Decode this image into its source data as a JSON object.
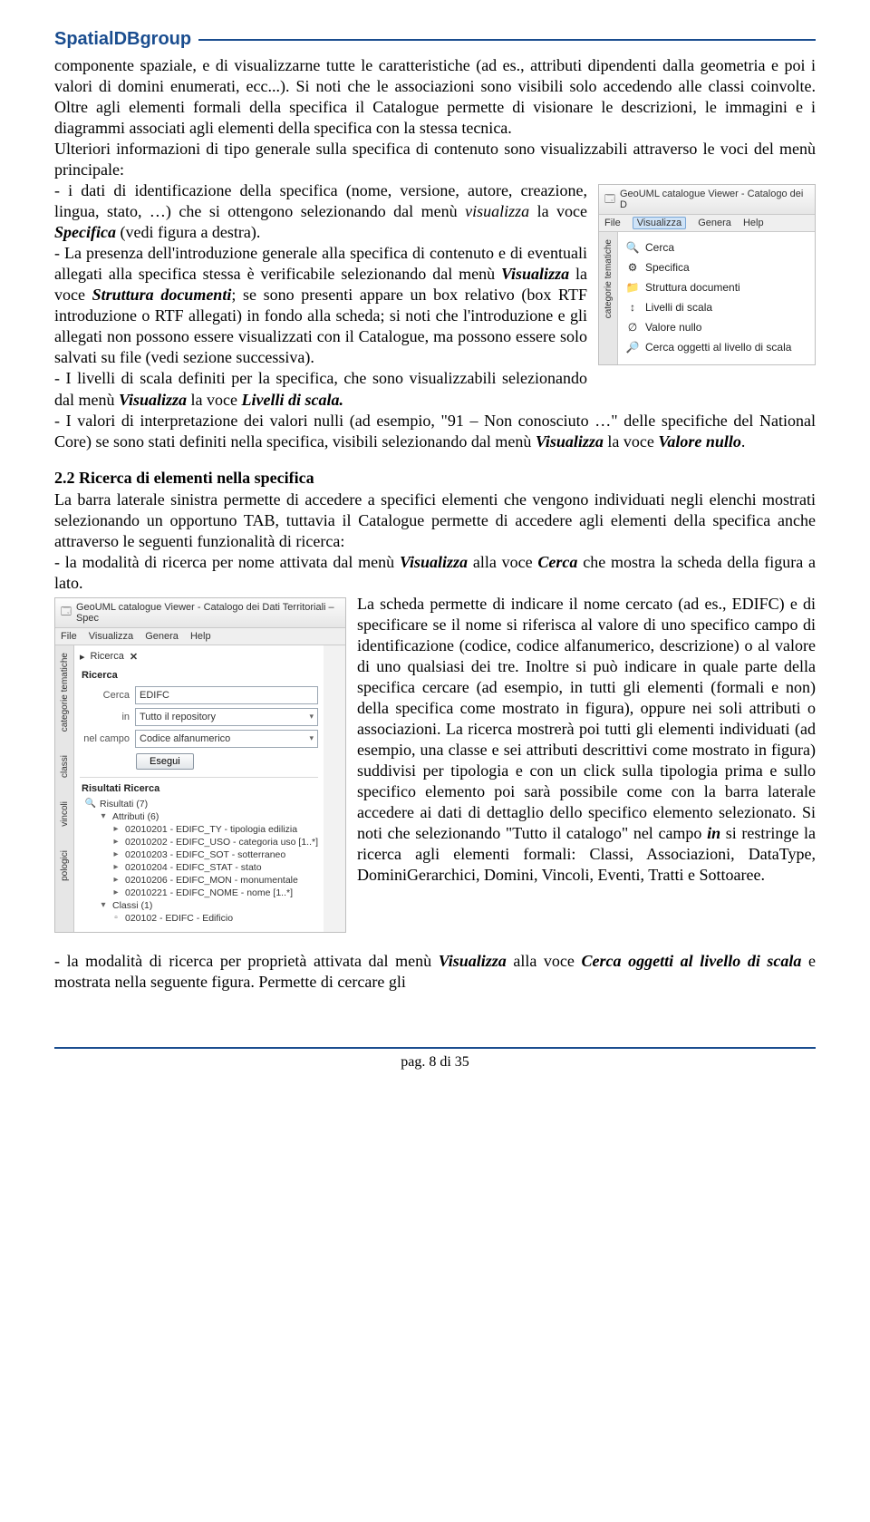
{
  "header": {
    "logo_text": "SpatialDBgroup"
  },
  "para1": "componente spaziale, e di visualizzarne tutte le caratteristiche (ad es., attributi dipendenti dalla geometria e poi i valori di domini enumerati, ecc...). Si noti che le associazioni sono visibili solo accedendo alle classi coinvolte. Oltre agli elementi formali della specifica il Catalogue permette di visionare le descrizioni, le immagini e i diagrammi associati agli elementi della specifica con la stessa tecnica.",
  "para2": "Ulteriori informazioni di tipo generale sulla specifica di contenuto sono visualizzabili attraverso le voci del menù principale:",
  "bullet1_a": "- i dati di identificazione della specifica (nome, versione, autore, creazione, lingua, stato, …) che si ottengono selezionando dal menù ",
  "bullet1_b": " la voce ",
  "bullet1_c": " (vedi figura a destra).",
  "em_visualizza_lc": "visualizza",
  "em_specifica": "Specifica",
  "bullet2_a": "- La presenza dell'introduzione generale alla specifica di contenuto e di eventuali allegati alla specifica stessa è verificabile selezionando dal menù ",
  "em_visualizza": "Visualizza",
  "bullet2_b": " la voce ",
  "em_struttura_doc": "Struttura documenti",
  "bullet2_c": "; se sono presenti appare un box relativo (box RTF introduzione o RTF allegati) in fondo alla scheda; si noti che l'introduzione e gli allegati non possono essere visualizzati con il Catalogue, ma possono essere solo salvati su file (vedi sezione successiva).",
  "bullet3_a": "- I livelli di scala definiti per la specifica, che sono visualizzabili selezionando dal menù ",
  "bullet3_b": " la voce ",
  "em_livelli": "Livelli di scala.",
  "bullet4_a": "- I valori di interpretazione dei valori nulli (ad esempio, \"91 – Non conosciuto …\" delle specifiche del National Core) se sono stati definiti nella specifica, visibili selezionando dal menù ",
  "bullet4_b": " la voce ",
  "em_valore_nullo": "Valore nullo",
  "period": ".",
  "section22_title": "2.2 Ricerca di elementi nella specifica",
  "section22_intro": "La barra laterale sinistra permette di accedere a specifici elementi che vengono individuati negli elenchi mostrati selezionando un opportuno TAB, tuttavia il Catalogue permette di accedere agli elementi della specifica anche attraverso le seguenti funzionalità di ricerca:",
  "section22_m1_a": "- la modalità di ricerca per nome attivata dal menù ",
  "section22_m1_b": " alla voce ",
  "em_cerca": "Cerca",
  "section22_m1_c": " che mostra la scheda della figura a lato.",
  "section22_m1_body_a": "La scheda permette di indicare il nome cercato (ad es., EDIFC) e di specificare se il nome si riferisca al valore di uno specifico campo di identificazione (codice, codice alfanumerico, descrizione) o al valore di uno qualsiasi dei tre. Inoltre si può indicare in quale parte della specifica cercare (ad esempio, in tutti gli elementi (formali e non) della specifica come mostrato in figura), oppure nei soli attributi o associazioni. La ricerca mostrerà poi tutti gli elementi individuati (ad esempio, una classe e sei attributi descrittivi come mostrato in figura) suddivisi per tipologia e con un click sulla tipologia prima e sullo specifico elemento poi sarà possibile come con la barra laterale accedere ai dati di dettaglio dello specifico elemento selezionato. Si noti che selezionando \"Tutto il catalogo\" nel campo ",
  "em_in": "in",
  "section22_m1_body_b": " si restringe la ricerca agli elementi formali: Classi, Associazioni, DataType, DominiGerarchici, Domini, Vincoli, Eventi, Tratti e Sottoaree.",
  "section22_m2_a": "- la modalità di ricerca per proprietà attivata dal menù ",
  "section22_m2_b": " alla voce ",
  "em_cerca_oggetti": "Cerca oggetti al livello di scala",
  "section22_m2_c": " e mostrata nella seguente figura. Permette di cercare gli",
  "fig_right": {
    "title": "GeoUML catalogue Viewer - Catalogo dei D",
    "menu": {
      "file": "File",
      "visualizza": "Visualizza",
      "genera": "Genera",
      "help": "Help"
    },
    "sidetab": "categorie tematiche",
    "items": {
      "cerca": "Cerca",
      "specifica": "Specifica",
      "struttura": "Struttura documenti",
      "livelli": "Livelli di scala",
      "valore": "Valore nullo",
      "cerca_ogg": "Cerca oggetti al livello di scala"
    }
  },
  "fig_left": {
    "title": "GeoUML catalogue Viewer - Catalogo dei Dati Territoriali – Spec",
    "menu": {
      "file": "File",
      "visualizza": "Visualizza",
      "genera": "Genera",
      "help": "Help"
    },
    "sidetabs": {
      "t1": "categorie tematiche",
      "t2": "classi",
      "t3": "vincoli",
      "t4": "pologici"
    },
    "panel": {
      "tab_label": "Ricerca",
      "close_x": "✕",
      "section": "Ricerca",
      "lbl_cerca": "Cerca",
      "val_cerca": "EDIFC",
      "lbl_in": "in",
      "val_in": "Tutto il repository",
      "lbl_campo": "nel campo",
      "val_campo": "Codice alfanumerico",
      "btn": "Esegui",
      "results_hdr": "Risultati Ricerca",
      "risultati": "Risultati (7)",
      "attributi": "Attributi (6)",
      "r1": "02010201 - EDIFC_TY - tipologia edilizia",
      "r2": "02010202 - EDIFC_USO - categoria uso [1..*]",
      "r3": "02010203 - EDIFC_SOT - sotterraneo",
      "r4": "02010204 - EDIFC_STAT - stato",
      "r5": "02010206 - EDIFC_MON - monumentale",
      "r6": "02010221 - EDIFC_NOME - nome [1..*]",
      "classi": "Classi (1)",
      "c1": "020102 - EDIFC - Edificio"
    }
  },
  "footer": {
    "page": "pag. 8 di 35"
  }
}
